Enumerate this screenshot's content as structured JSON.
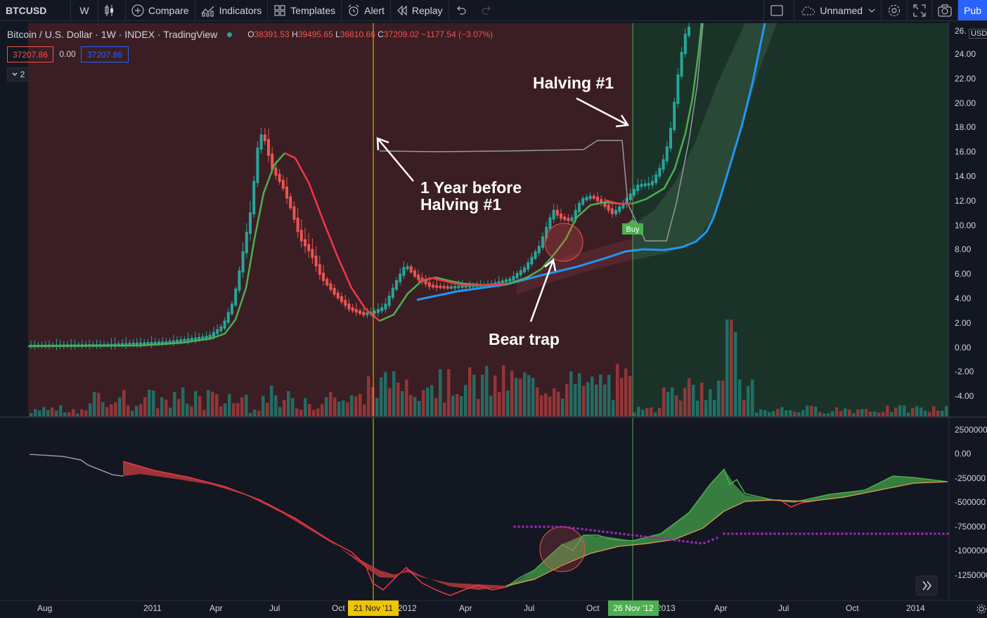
{
  "toolbar": {
    "symbol": "BTCUSD",
    "interval": "W",
    "compare": "Compare",
    "indicators": "Indicators",
    "templates": "Templates",
    "alert": "Alert",
    "replay": "Replay",
    "layout_name": "Unnamed",
    "publish": "Pub"
  },
  "legend": {
    "source": "Bitcoin / U.S. Dollar · 1W · INDEX · TradingView",
    "o_label": "O",
    "o_value": "38391.53",
    "h_label": "H",
    "h_value": "39495.65",
    "l_label": "L",
    "l_value": "36810.66",
    "c_label": "C",
    "c_value": "37209.02",
    "change": "−1177.54 (−3.07%)",
    "price_sell": "37207.86",
    "spread": "0.00",
    "price_buy": "37207.86",
    "collapsed_count": "2"
  },
  "annotations": {
    "halving": "Halving #1",
    "year_before_line1": "1 Year before",
    "year_before_line2": "Halving #1",
    "bear_trap": "Bear trap",
    "buy_tag": "Buy"
  },
  "price_axis": {
    "currency": "USD",
    "top_partial": "26.",
    "labels": [
      "24.00",
      "22.00",
      "20.00",
      "18.00",
      "16.00",
      "14.00",
      "12.00",
      "10.00",
      "8.00",
      "6.00",
      "4.00",
      "2.00",
      "0.00",
      "-2.00",
      "-4.00"
    ]
  },
  "osc_axis": {
    "labels": [
      "2500000",
      "0.00",
      "-250000",
      "-500000",
      "-750000",
      "-1000000",
      "-1250000"
    ]
  },
  "time_axis": {
    "labels": [
      "Aug",
      "2011",
      "Apr",
      "Jul",
      "Oct",
      "2012",
      "Apr",
      "Jul",
      "Oct",
      "2013",
      "Apr",
      "Jul",
      "Oct",
      "2014"
    ],
    "flag_left": "21 Nov '11",
    "flag_right": "26 Nov '12"
  },
  "colors": {
    "background": "#131722",
    "up": "#26a69a",
    "down": "#ef5350",
    "ema_fast": "#4caf50",
    "ema_red": "#f23645",
    "ma_blue": "#2196f3",
    "bg_red_zone": "#3a1e24",
    "bg_green_zone": "#1b3229",
    "vline_left": "#f0c400",
    "vline_right": "#4caf50",
    "dotted": "#9c27b0"
  }
}
